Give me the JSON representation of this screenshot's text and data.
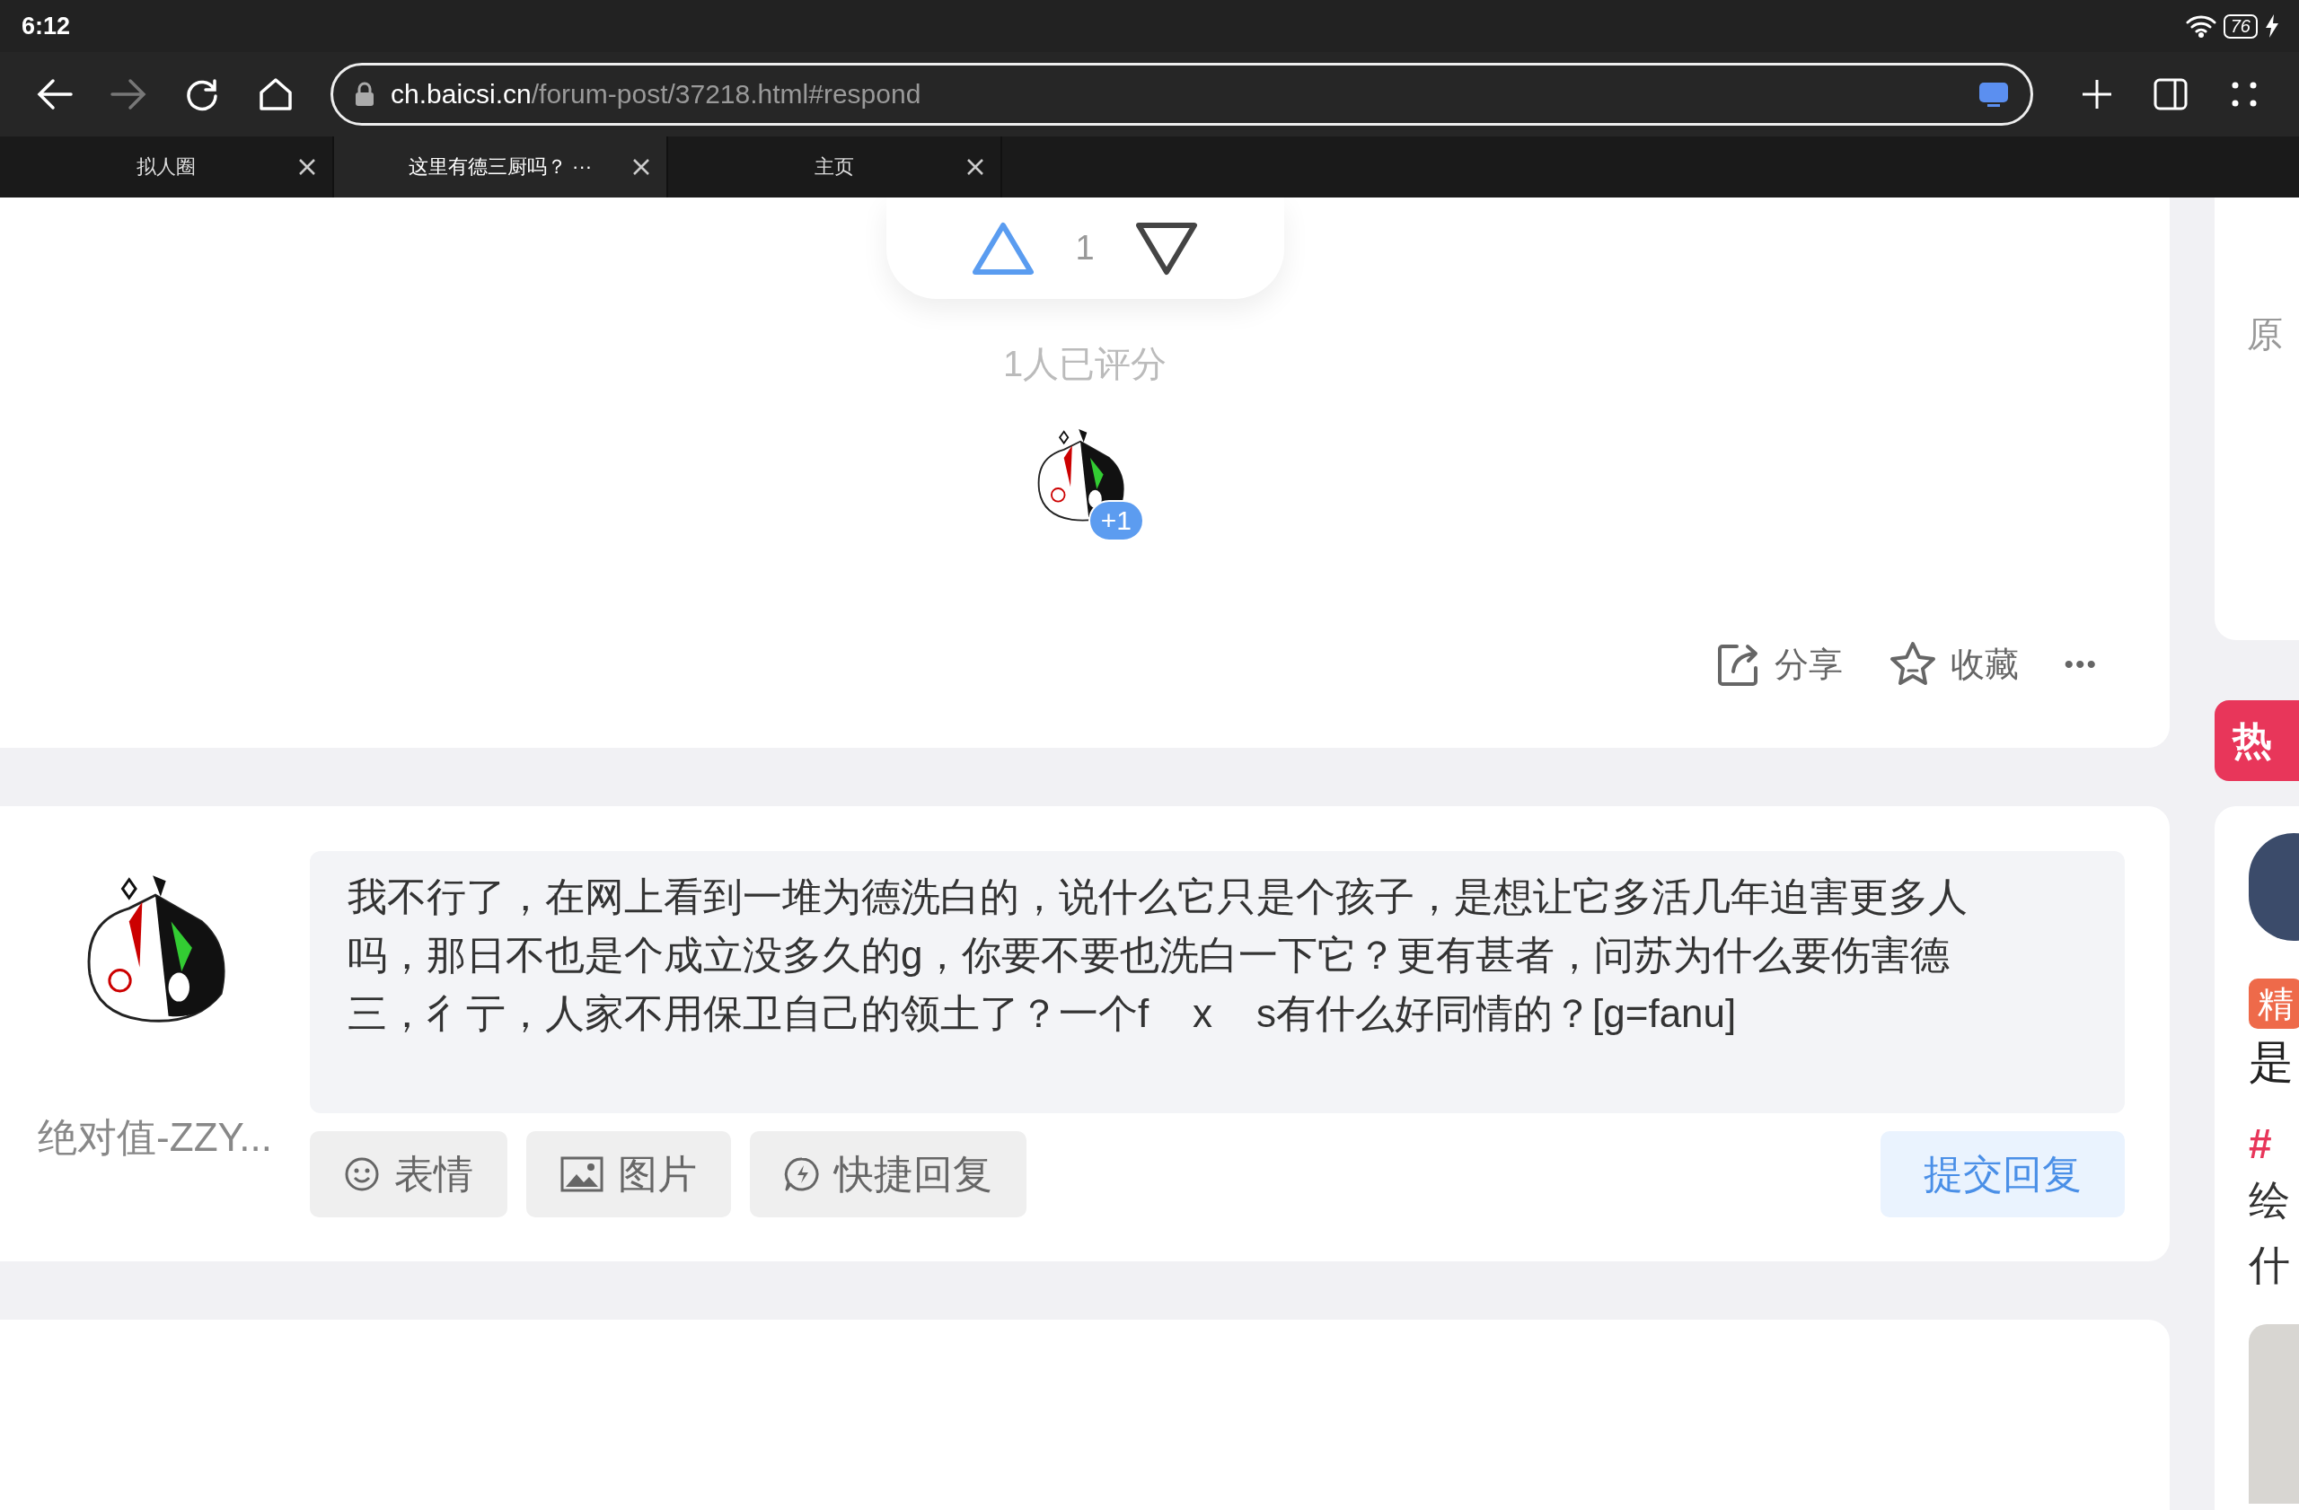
{
  "status_bar": {
    "time": "6:12",
    "battery": "76",
    "charging": true
  },
  "browser": {
    "url_host": "ch.baicsi.cn",
    "url_path": "/forum-post/37218.html#respond",
    "forward_disabled": true,
    "tabs": [
      {
        "label": "拟人圈",
        "selected": false
      },
      {
        "label": "这里有德三厨吗？ ···",
        "selected": true
      },
      {
        "label": "主页",
        "selected": false
      }
    ]
  },
  "vote": {
    "count": "1",
    "rated_text": "1人已评分",
    "rater_badge": "+1"
  },
  "actions": [
    {
      "kind": "share",
      "label": "分享"
    },
    {
      "kind": "favorite",
      "label": "收藏"
    },
    {
      "kind": "more",
      "label": "•••"
    }
  ],
  "reply": {
    "username": "绝对值-ZZY...",
    "text": "我不行了，在网上看到一堆为德洗白的，说什么它只是个孩子，是想让它多活几年迫害更多人吗，那日不也是个成立没多久的g，你要不要也洗白一下它？更有甚者，问苏为什么要伤害德三，彳亍，人家不用保卫自己的领土了？一个f    x    s有什么好同情的？[g=fanu]",
    "tools": [
      {
        "kind": "emoji",
        "label": "表情"
      },
      {
        "kind": "image",
        "label": "图片"
      },
      {
        "kind": "quick",
        "label": "快捷回复"
      }
    ],
    "submit": "提交回复"
  },
  "sidebar": {
    "card_text": "原",
    "hot_tab": "热",
    "badge": "精",
    "title_char": "是",
    "tag": "#",
    "lines": [
      "绘",
      "什"
    ]
  }
}
